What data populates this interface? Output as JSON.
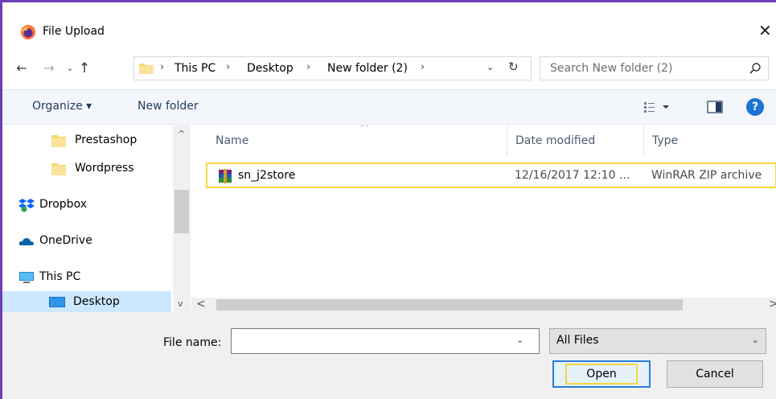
{
  "window": {
    "title": "File Upload",
    "close_glyph": "✕"
  },
  "nav_buttons": {
    "back": "←",
    "forward": "→",
    "recent": "⌄",
    "up": "↑"
  },
  "address": {
    "crumbs": [
      "This PC",
      "Desktop",
      "New folder (2)"
    ],
    "separator": "›",
    "dropdown": "⌄",
    "refresh": "↻"
  },
  "search": {
    "placeholder": "Search New folder (2)"
  },
  "toolbar": {
    "organize_label": "Organize ▾",
    "new_folder_label": "New folder",
    "help_label": "?"
  },
  "nav_pane": {
    "items": [
      {
        "label": "Prestashop",
        "icon": "folder-icon"
      },
      {
        "label": "Wordpress",
        "icon": "folder-icon"
      },
      {
        "label": "Dropbox",
        "icon": "dropbox-icon"
      },
      {
        "label": "OneDrive",
        "icon": "onedrive-icon"
      },
      {
        "label": "This PC",
        "icon": "computer-icon"
      },
      {
        "label": "Desktop",
        "icon": "desktop-icon",
        "selected": true
      }
    ],
    "scroll_up": "^",
    "scroll_down": "v"
  },
  "columns": {
    "name": "Name",
    "date_modified": "Date modified",
    "type": "Type",
    "sort_glyph": "^"
  },
  "files": [
    {
      "name": "sn_j2store",
      "date_modified": "12/16/2017 12:10 ...",
      "type": "WinRAR ZIP archive",
      "icon": "winrar-icon"
    }
  ],
  "hscroll": {
    "left": "<",
    "right": ">"
  },
  "footer": {
    "file_name_label": "File name:",
    "file_name_value": "",
    "file_name_dropdown": "⌄",
    "filter_value": "All Files",
    "filter_arrow": "⌄",
    "open_label": "Open",
    "cancel_label": "Cancel"
  },
  "colors": {
    "accent": "#6c3fb5",
    "highlight": "#f5d642",
    "selection": "#cce8ff",
    "help": "#1a73d6"
  }
}
